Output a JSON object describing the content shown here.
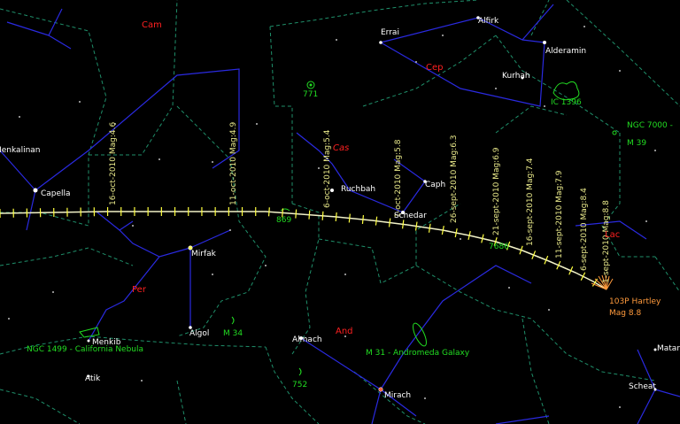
{
  "constellations": [
    "Cam",
    "Cep",
    "Cas",
    "Per",
    "And",
    "Lac"
  ],
  "stars": [
    "Errai",
    "Alfirk",
    "Alderamin",
    "Kurhah",
    "Capella",
    "Ruchbah",
    "Caph",
    "Schedar",
    "Mirfak",
    "Algol",
    "Almach",
    "Menkib",
    "Atik",
    "Mirach",
    "Matar",
    "Scheat",
    "Menkalinan"
  ],
  "deep_sky": [
    "771",
    "IC 1396",
    "NGC 7000 -",
    "M 39",
    "869",
    "7686",
    "M 34",
    "M 31 - Andromeda Galaxy",
    "752",
    "NGC 1499 - California Nebula"
  ],
  "comet": {
    "name": "103P Hartley",
    "magnitude": "Mag 8.8"
  },
  "date_labels": [
    "16-oct-2010  Mag:4.6",
    "11-oct-2010  Mag:4.9",
    "6-oct-2010  Mag:5.4",
    "1-oct-2010  Mag:5.8",
    "26-sept-2010  Mag:6.3",
    "21-sept-2010  Mag:6.9",
    "16-sept-2010  Mag:7.4",
    "11-sept-2010  Mag:7.9",
    "6-sept-2010  Mag:8.4",
    "1-sept-2010  Mag:8.8"
  ],
  "colors": {
    "background": "#000000",
    "constellation_lines": "#2a2ae0",
    "boundaries": "#1f8f6a",
    "track": "#f2f2c8",
    "ticks": "#ffff40",
    "labels": "#ffffff",
    "const_names": "#ff2020",
    "dso": "#22dd22",
    "comet": "#ff9a3c"
  }
}
